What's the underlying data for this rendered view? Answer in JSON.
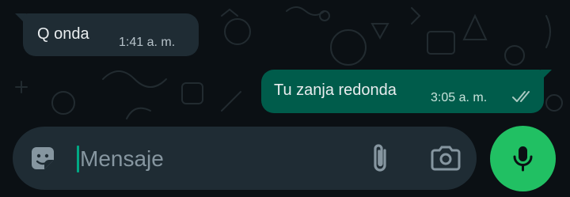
{
  "colors": {
    "background": "#0b1014",
    "incoming_bubble": "#1f2c34",
    "outgoing_bubble": "#005c4b",
    "input_bar": "#1f2c34",
    "accent_green": "#21c063",
    "cursor": "#00a884"
  },
  "messages": [
    {
      "direction": "incoming",
      "text": "Q onda",
      "time": "1:41 a. m."
    },
    {
      "direction": "outgoing",
      "text": "Tu zanja redonda",
      "time": "3:05 a. m.",
      "status_icon": "double-check-icon"
    }
  ],
  "composer": {
    "placeholder": "Mensaje",
    "value": "",
    "icons": {
      "left": "sticker-icon",
      "attach": "paperclip-icon",
      "camera": "camera-icon",
      "send": "microphone-icon"
    }
  }
}
